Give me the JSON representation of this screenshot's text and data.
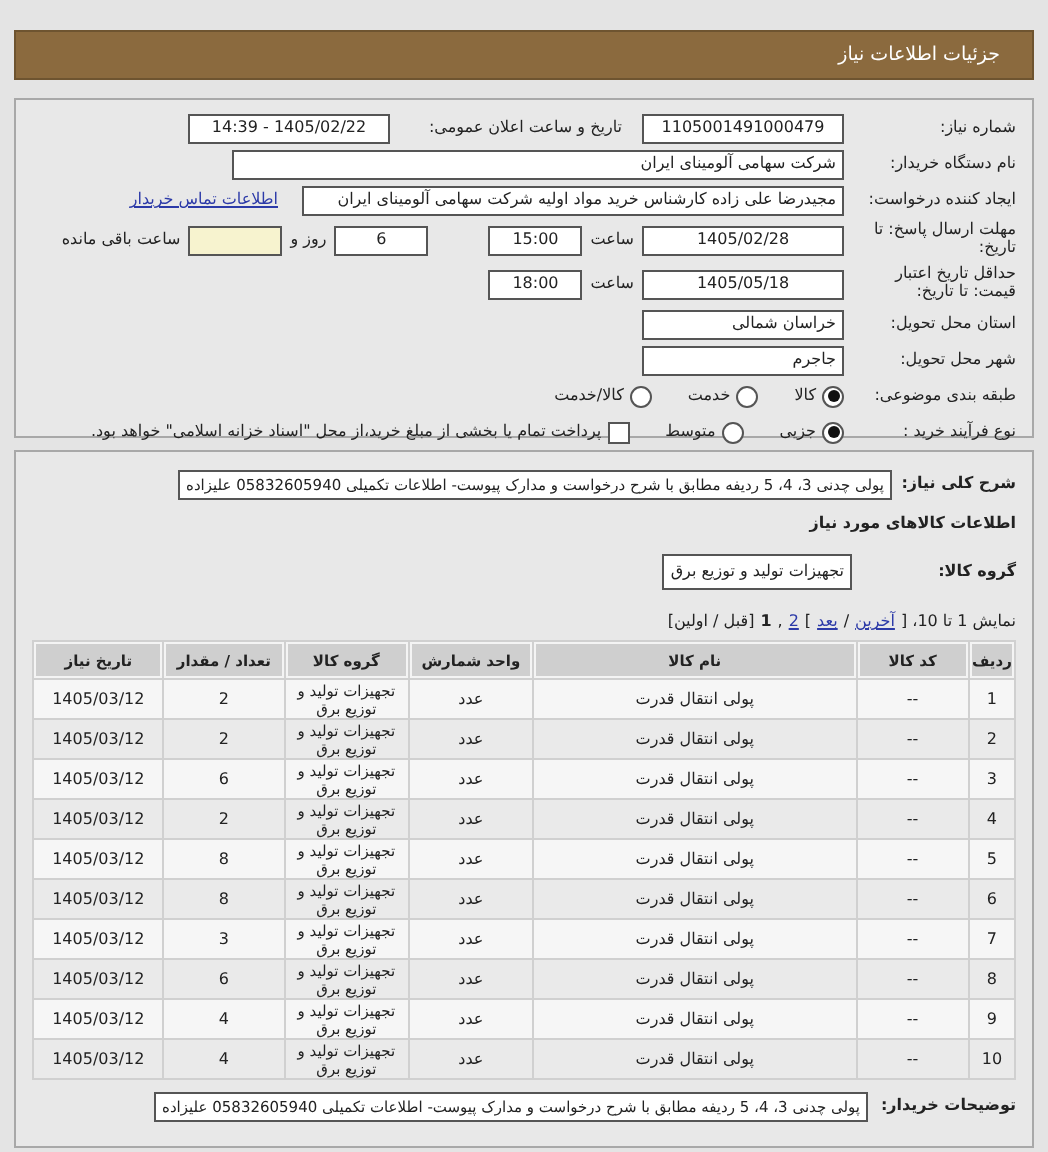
{
  "header": {
    "title": "جزئیات اطلاعات نیاز"
  },
  "need_number": {
    "label": "شماره نیاز:",
    "value": "1105001491000479"
  },
  "announce": {
    "label": "تاریخ و ساعت اعلان عمومی:",
    "value": "1405/02/22 - 14:39"
  },
  "buyer": {
    "label": "نام دستگاه خریدار:",
    "value": "شرکت سهامی آلومینای ایران"
  },
  "creator": {
    "label": "ایجاد کننده درخواست:",
    "value": "مجیدرضا علی زاده کارشناس خرید مواد اولیه شرکت سهامی آلومینای ایران",
    "link": "اطلاعات تماس خریدار"
  },
  "deadline": {
    "label": "مهلت ارسال پاسخ: تا تاریخ:",
    "date": "1405/02/28",
    "time_label": "ساعت",
    "time": "15:00",
    "days": "6",
    "days_label": "روز و",
    "remaining_label": "ساعت باقی مانده"
  },
  "validity": {
    "label": "حداقل تاریخ اعتبار قیمت: تا تاریخ:",
    "date": "1405/05/18",
    "time_label": "ساعت",
    "time": "18:00"
  },
  "province": {
    "label": "استان محل تحویل:",
    "value": "خراسان شمالی"
  },
  "city": {
    "label": "شهر محل تحویل:",
    "value": "جاجرم"
  },
  "category": {
    "label": "طبقه بندی موضوعی:",
    "options": [
      {
        "kind": "radio",
        "label": "کالا",
        "selected": true
      },
      {
        "kind": "radio",
        "label": "خدمت",
        "selected": false
      },
      {
        "kind": "radio",
        "label": "کالا/خدمت",
        "selected": false
      }
    ]
  },
  "process": {
    "label": "نوع فرآیند خرید :",
    "options": [
      {
        "kind": "radio",
        "label": "جزیی",
        "selected": true
      },
      {
        "kind": "radio",
        "label": "متوسط",
        "selected": false
      },
      {
        "kind": "checkbox",
        "label": "پرداخت تمام یا بخشی از مبلغ خرید،از محل \"اسناد خزانه اسلامی\" خواهد بود.",
        "selected": false
      }
    ]
  },
  "description": {
    "label": "شرح کلی نیاز:",
    "value": "پولی چدنی 3، 4، 5 ردیفه مطابق با شرح درخواست و مدارک پیوست- اطلاعات تکمیلی 05832605940 علیزاده"
  },
  "goods_title": "اطلاعات کالاهای مورد نیاز",
  "goods_group": {
    "label": "گروه کالا:",
    "value": "تجهیزات تولید و توزیع برق"
  },
  "pager": [
    {
      "kind": "text",
      "text": "نمایش 1 تا 10، ["
    },
    {
      "kind": "link",
      "text": "آخرین"
    },
    {
      "kind": "text",
      "text": "/"
    },
    {
      "kind": "link",
      "text": "بعد"
    },
    {
      "kind": "text",
      "text": "]"
    },
    {
      "kind": "link",
      "text": "2"
    },
    {
      "kind": "text",
      "text": ","
    },
    {
      "kind": "current",
      "text": "1"
    },
    {
      "kind": "text",
      "text": "[قبل / اولین]"
    }
  ],
  "table": {
    "columns": [
      "ردیف",
      "کد کالا",
      "نام کالا",
      "واحد شمارش",
      "گروه کالا",
      "تعداد / مقدار",
      "تاریخ نیاز"
    ],
    "rows": [
      [
        "1",
        "--",
        "پولی انتقال قدرت",
        "عدد",
        "تجهیزات تولید و توزیع برق",
        "2",
        "1405/03/12"
      ],
      [
        "2",
        "--",
        "پولی انتقال قدرت",
        "عدد",
        "تجهیزات تولید و توزیع برق",
        "2",
        "1405/03/12"
      ],
      [
        "3",
        "--",
        "پولی انتقال قدرت",
        "عدد",
        "تجهیزات تولید و توزیع برق",
        "6",
        "1405/03/12"
      ],
      [
        "4",
        "--",
        "پولی انتقال قدرت",
        "عدد",
        "تجهیزات تولید و توزیع برق",
        "2",
        "1405/03/12"
      ],
      [
        "5",
        "--",
        "پولی انتقال قدرت",
        "عدد",
        "تجهیزات تولید و توزیع برق",
        "8",
        "1405/03/12"
      ],
      [
        "6",
        "--",
        "پولی انتقال قدرت",
        "عدد",
        "تجهیزات تولید و توزیع برق",
        "8",
        "1405/03/12"
      ],
      [
        "7",
        "--",
        "پولی انتقال قدرت",
        "عدد",
        "تجهیزات تولید و توزیع برق",
        "3",
        "1405/03/12"
      ],
      [
        "8",
        "--",
        "پولی انتقال قدرت",
        "عدد",
        "تجهیزات تولید و توزیع برق",
        "6",
        "1405/03/12"
      ],
      [
        "9",
        "--",
        "پولی انتقال قدرت",
        "عدد",
        "تجهیزات تولید و توزیع برق",
        "4",
        "1405/03/12"
      ],
      [
        "10",
        "--",
        "پولی انتقال قدرت",
        "عدد",
        "تجهیزات تولید و توزیع برق",
        "4",
        "1405/03/12"
      ]
    ]
  },
  "buyer_notes": {
    "label": "توضیحات خریدار:",
    "value": "پولی چدنی 3، 4، 5 ردیفه مطابق با شرح درخواست و مدارک پیوست- اطلاعات تکمیلی 05832605940 علیزاده"
  }
}
